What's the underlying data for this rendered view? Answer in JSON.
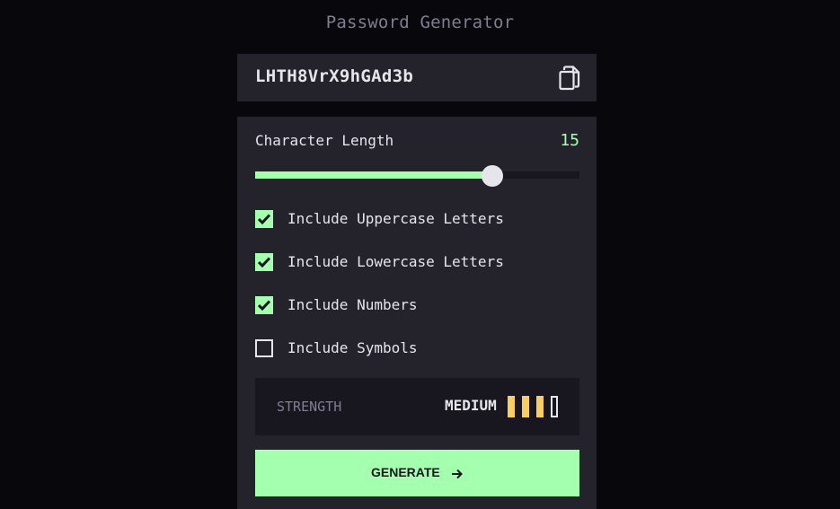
{
  "app": {
    "title": "Password Generator"
  },
  "output": {
    "password": "LHTH8VrX9hGAd3b",
    "copy_icon": "copy-icon"
  },
  "length": {
    "label": "Character Length",
    "value": "15",
    "slider_fraction": 0.73
  },
  "options": [
    {
      "label": "Include Uppercase Letters",
      "checked": true
    },
    {
      "label": "Include Lowercase Letters",
      "checked": true
    },
    {
      "label": "Include Numbers",
      "checked": true
    },
    {
      "label": "Include Symbols",
      "checked": false
    }
  ],
  "strength": {
    "label": "STRENGTH",
    "value": "MEDIUM",
    "bars_filled": 3,
    "bars_total": 4
  },
  "generate": {
    "label": "GENERATE",
    "icon": "arrow-right-icon"
  },
  "colors": {
    "accent": "#a4ffaf",
    "strength_medium": "#f8cd65",
    "panel": "#24232c",
    "background": "#08070b"
  }
}
